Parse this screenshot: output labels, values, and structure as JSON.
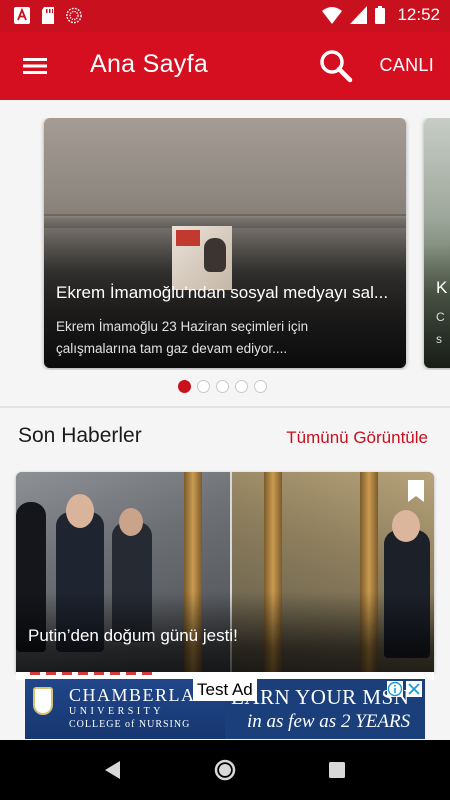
{
  "status_bar": {
    "time": "12:52",
    "icons": [
      "app-a-icon",
      "sd-card-icon",
      "dotted-circle-icon",
      "wifi-icon",
      "signal-icon",
      "battery-icon"
    ]
  },
  "app_bar": {
    "title": "Ana Sayfa",
    "live_label": "CANLI",
    "color": "#d50f1f"
  },
  "carousel": {
    "slides": [
      {
        "title": "Ekrem İmamoğlu'ndan sosyal medyayı sal...",
        "description": "Ekrem İmamoğlu 23 Haziran seçimleri için çalışmalarına tam gaz devam ediyor...."
      },
      {
        "title_fragment": "K",
        "desc_line1": "C",
        "desc_line2": "s"
      }
    ],
    "active_index": 0,
    "dot_count": 5
  },
  "section": {
    "title": "Son Haberler",
    "see_all": "Tümünü Görüntüle"
  },
  "news": [
    {
      "title": "Putin’den doğum günü jesti!"
    }
  ],
  "ad": {
    "label": "Test Ad",
    "brand": "CHAMBERLAIN",
    "university": "UNIVERSITY",
    "college": "COLLEGE of NURSING",
    "headline": "EARN YOUR MSN",
    "subline": "in as few as 2 YEARS"
  },
  "accent_color": "#c8101e"
}
